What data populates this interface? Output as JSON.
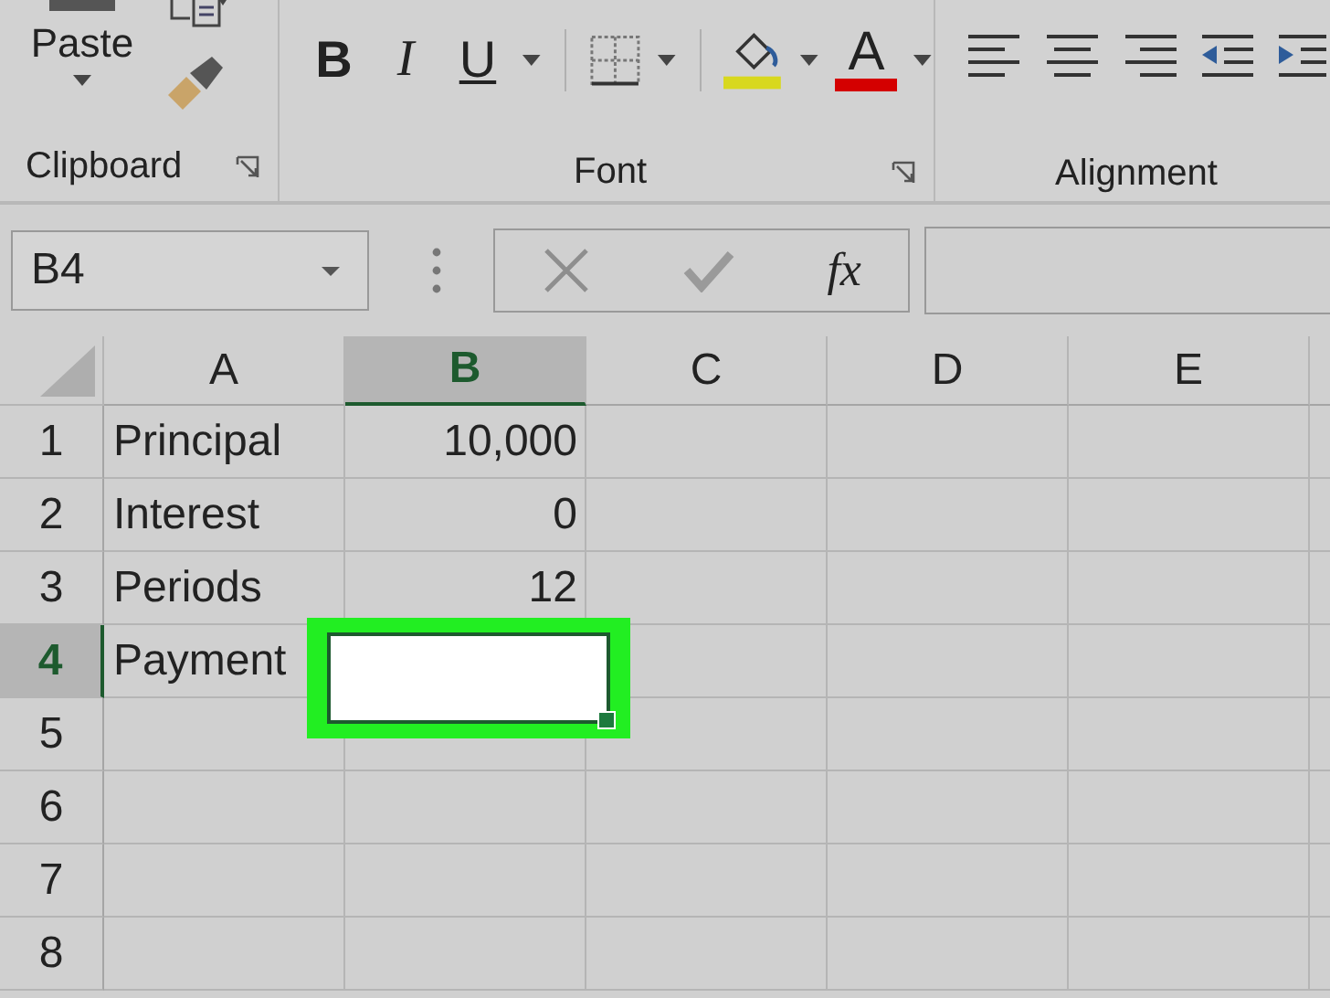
{
  "ribbon": {
    "paste_label": "Paste",
    "font_buttons": [
      {
        "kind": "bold",
        "label": "B"
      },
      {
        "kind": "italic",
        "label": "I"
      },
      {
        "kind": "underline",
        "label": "U"
      }
    ],
    "font_color_label": "A",
    "groups": [
      {
        "label": "Clipboard",
        "launcher": true
      },
      {
        "label": "Font",
        "launcher": true
      },
      {
        "label": "Alignment",
        "launcher": false
      }
    ]
  },
  "formula_bar": {
    "name_box": "B4",
    "function_label": "fx"
  },
  "sheet": {
    "columns": [
      {
        "label": "A",
        "selected": false
      },
      {
        "label": "B",
        "selected": true
      },
      {
        "label": "C",
        "selected": false
      },
      {
        "label": "D",
        "selected": false
      },
      {
        "label": "E",
        "selected": false
      }
    ],
    "rows": [
      {
        "label": "1",
        "selected": false,
        "cells": [
          "Principal",
          "10,000"
        ]
      },
      {
        "label": "2",
        "selected": false,
        "cells": [
          "Interest",
          "0"
        ]
      },
      {
        "label": "3",
        "selected": false,
        "cells": [
          "Periods",
          "12"
        ]
      },
      {
        "label": "4",
        "selected": true,
        "cells": [
          "Payment"
        ]
      },
      {
        "label": "5",
        "selected": false,
        "cells": []
      },
      {
        "label": "6",
        "selected": false,
        "cells": []
      },
      {
        "label": "7",
        "selected": false,
        "cells": []
      },
      {
        "label": "8",
        "selected": false,
        "cells": []
      }
    ]
  }
}
